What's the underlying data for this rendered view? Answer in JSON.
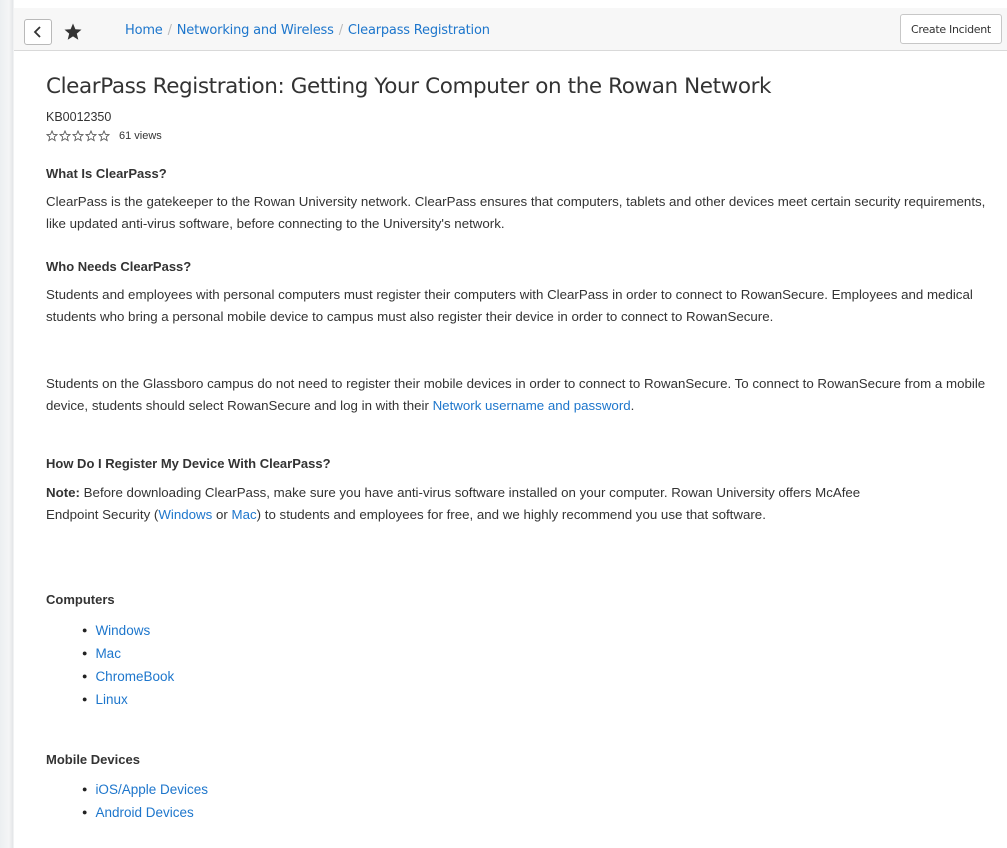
{
  "topbar": {
    "breadcrumb": [
      "Home",
      "Networking and Wireless",
      "Clearpass Registration"
    ],
    "create_incident_label": "Create Incident"
  },
  "article": {
    "title": "ClearPass Registration: Getting Your Computer on the Rowan Network",
    "kb_number": "KB0012350",
    "rating_stars": 0,
    "rating_max": 5,
    "views": "61 views",
    "sections": {
      "what_heading": "What Is ClearPass?",
      "what_text": "ClearPass is the gatekeeper to the Rowan University network. ClearPass ensures that computers, tablets and other devices meet certain security requirements, like updated anti-virus software, before connecting to the University's network.",
      "who_heading": "Who Needs ClearPass?",
      "who_text_1": "Students and employees with personal computers must register their computers with ClearPass in order to connect to RowanSecure. Employees and medical students who bring a personal mobile device to campus must also register their device in order to connect to RowanSecure.",
      "who_text_2_before": "Students on the Glassboro campus do not need to register their mobile devices in order to connect to RowanSecure. To connect to RowanSecure from a mobile device, students should select RowanSecure and log in with their ",
      "who_text_2_link": "Network username and password",
      "who_text_2_after": ".",
      "how_heading": "How Do I Register My Device With ClearPass?",
      "note_label": "Note:",
      "note_text_1": " Before downloading ClearPass, make sure you have anti-virus software installed on your computer. Rowan University offers McAfee Endpoint Security (",
      "note_link_windows": "Windows",
      "note_text_or": " or ",
      "note_link_mac": "Mac",
      "note_text_2": ") to students and employees for free, and we highly recommend you use that software.",
      "computers_heading": "Computers",
      "computers_links": [
        "Windows",
        "Mac",
        "ChromeBook",
        "Linux"
      ],
      "mobile_heading": "Mobile Devices",
      "mobile_links": [
        "iOS/Apple Devices",
        "Android Devices"
      ]
    }
  },
  "colors": {
    "link": "#1d76cc",
    "text": "#333333",
    "bar": "#f7f7f7"
  },
  "icons": {
    "back": "chevron-left-icon",
    "favorite": "star-icon",
    "rating": "star-outline-icon"
  }
}
